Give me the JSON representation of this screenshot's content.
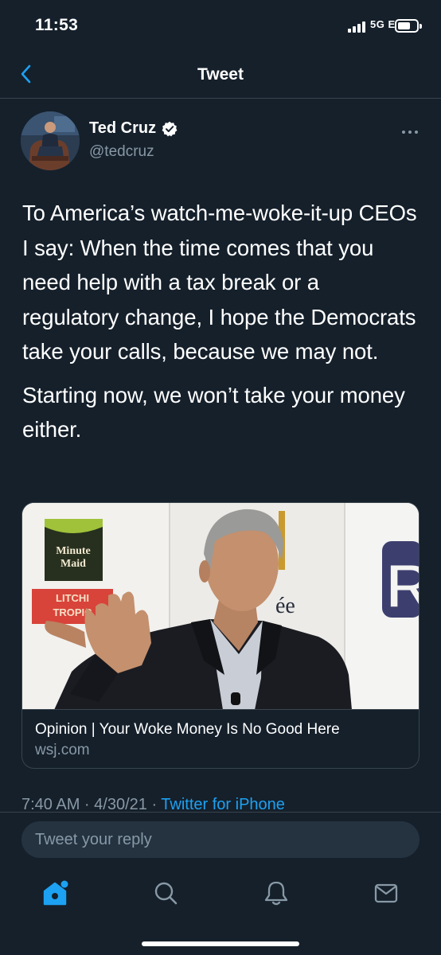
{
  "status_bar": {
    "time": "11:53",
    "network": "5G E",
    "signal_bars": 4,
    "battery_level": 0.7
  },
  "header": {
    "title": "Tweet",
    "back_icon": "chevron-left-icon"
  },
  "tweet": {
    "author": {
      "name": "Ted Cruz",
      "handle": "@tedcruz",
      "verified": true
    },
    "text": [
      "To America’s watch-me-woke-it-up CEOs I say: When the time comes that you need help with a tax break or a regulatory change, I hope the Democrats take your calls, because we may not.",
      "Starting now, we won’t take your money either."
    ],
    "card": {
      "title": "Opinion | Your Woke Money Is No Good Here",
      "domain": "wsj.com",
      "image_text": {
        "logo_line1": "Minute",
        "logo_line2": "Maid",
        "sign_line1": "LITCHI",
        "sign_line2": "TROPIC",
        "letter_right": "R",
        "letters_mid": "ée"
      }
    },
    "meta": {
      "timestamp": "7:40 AM · 4/30/21 · ",
      "source": "Twitter for iPhone"
    }
  },
  "reply": {
    "placeholder": "Tweet your reply"
  },
  "tab_bar": {
    "items": [
      {
        "name": "home",
        "icon": "home-icon",
        "active": true
      },
      {
        "name": "search",
        "icon": "search-icon",
        "active": false
      },
      {
        "name": "notifications",
        "icon": "bell-icon",
        "active": false
      },
      {
        "name": "messages",
        "icon": "mail-icon",
        "active": false
      }
    ]
  },
  "colors": {
    "background": "#15202B",
    "accent": "#1DA1F2",
    "secondary_text": "#8899A6",
    "divider": "#38444D"
  }
}
